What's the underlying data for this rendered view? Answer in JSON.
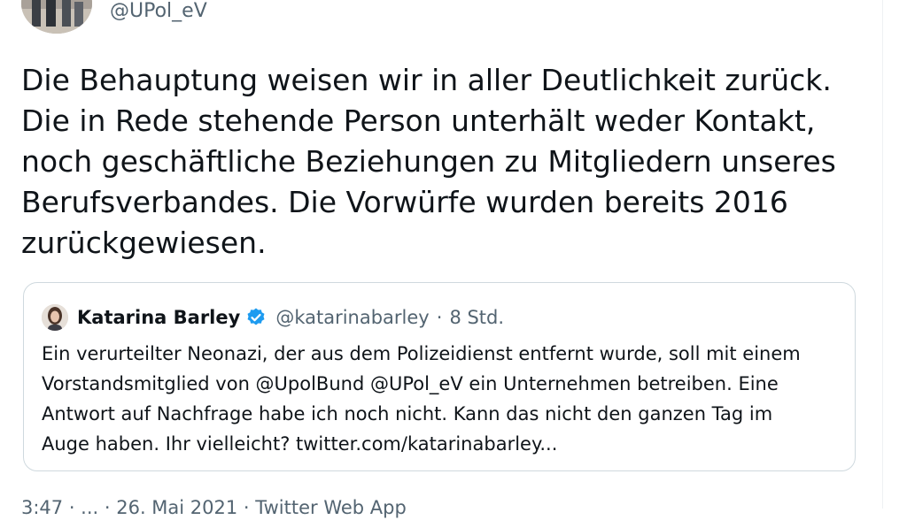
{
  "tweet": {
    "author_handle": "@UPol_eV",
    "text": "Die Behauptung weisen wir in aller Deutlichkeit zurück.\nDie in Rede stehende Person unterhält weder Kontakt,\nnoch geschäftliche Beziehungen zu Mitgliedern unseres\nBerufsverbandes. Die Vorwürfe wurden bereits 2016\nzurückgewiesen.",
    "meta_partial": "3:47 · ... · 26. Mai 2021 · Twitter Web App"
  },
  "quoted_tweet": {
    "author_name": "Katarina Barley",
    "author_handle": "@katarinabarley",
    "separator": "·",
    "time": "8 Std.",
    "text": "Ein verurteilter Neonazi, der aus dem Polizeidienst entfernt wurde, soll mit einem\nVorstandsmitglied von @UpolBund @UPol_eV ein Unternehmen betreiben. Eine\nAntwort auf Nachfrage habe ich noch nicht. Kann das nicht den ganzen Tag im\nAuge haben. Ihr vielleicht? twitter.com/katarinabarley...",
    "verified_icon": "verified-badge-icon"
  },
  "colors": {
    "text_primary": "#0f1419",
    "text_secondary": "#536471",
    "border": "#cfd9de",
    "verified_blue": "#1d9bf0"
  }
}
